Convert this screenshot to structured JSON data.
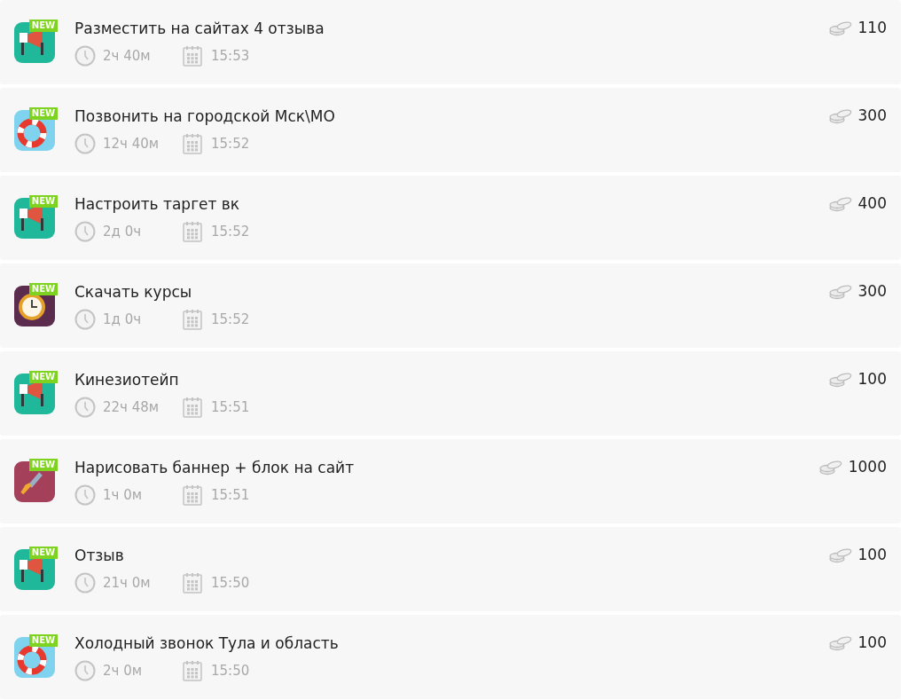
{
  "tasks": [
    {
      "kind": "megaphone",
      "badge": "NEW",
      "title": "Разместить на сайтах 4 отзыва",
      "duration": "2ч 40м",
      "time": "15:53",
      "reward": "110"
    },
    {
      "kind": "lifebuoy",
      "badge": "NEW",
      "title": "Позвонить на городской Мск\\МО",
      "duration": "12ч 40м",
      "time": "15:52",
      "reward": "300"
    },
    {
      "kind": "megaphone",
      "badge": "NEW",
      "title": "Настроить таргет вк",
      "duration": "2д 0ч",
      "time": "15:52",
      "reward": "400"
    },
    {
      "kind": "clock",
      "badge": "NEW",
      "title": "Скачать курсы",
      "duration": "1д 0ч",
      "time": "15:52",
      "reward": "300"
    },
    {
      "kind": "megaphone",
      "badge": "NEW",
      "title": "Кинезиотейп",
      "duration": "22ч 48м",
      "time": "15:51",
      "reward": "100"
    },
    {
      "kind": "brush",
      "badge": "NEW",
      "title": "Нарисовать баннер + блок на сайт",
      "duration": "1ч 0м",
      "time": "15:51",
      "reward": "1000"
    },
    {
      "kind": "megaphone",
      "badge": "NEW",
      "title": "Отзыв",
      "duration": "21ч 0м",
      "time": "15:50",
      "reward": "100"
    },
    {
      "kind": "lifebuoy",
      "badge": "NEW",
      "title": "Холодный звонок Тула и область",
      "duration": "2ч 0м",
      "time": "15:50",
      "reward": "100"
    }
  ]
}
